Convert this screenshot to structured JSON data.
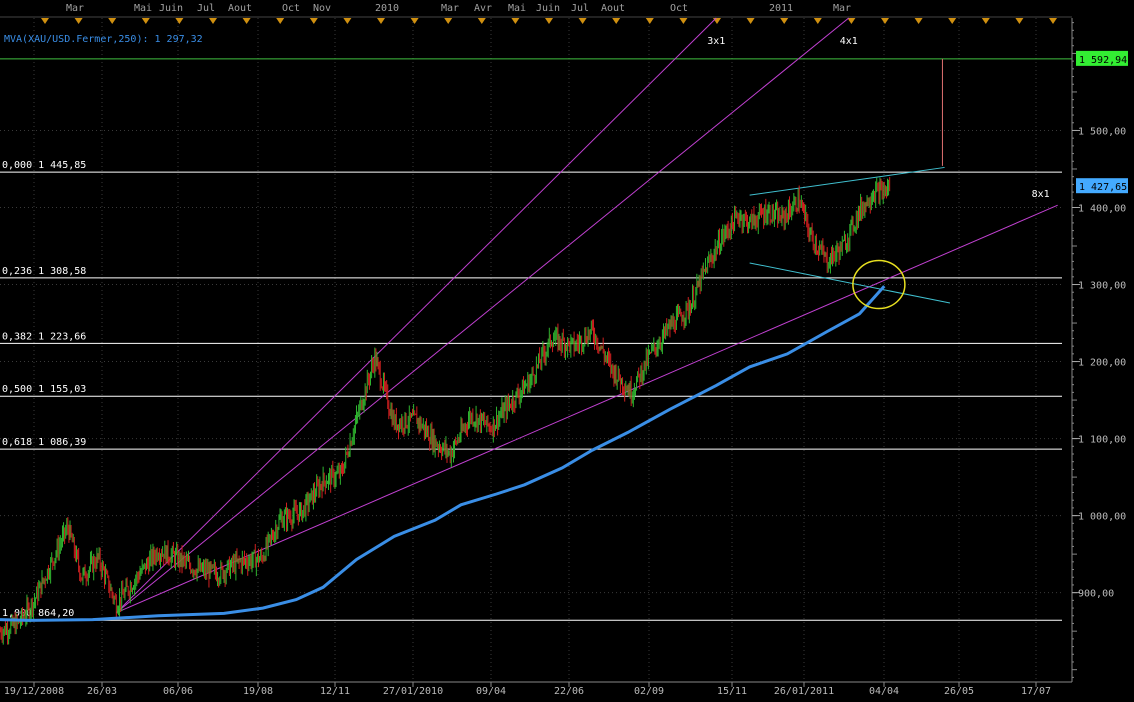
{
  "indicator_label": "MVA(XAU/USD.Fermer,250): 1 297,32",
  "colors": {
    "background": "#000000",
    "grid": "#3a3a3a",
    "bull": "#2fb52f",
    "bear": "#d02020",
    "mva": "#3a8ee6",
    "fan": "#c040d0",
    "fib": "#ffffff",
    "channel": "#40c0d0",
    "target_line": "#40c040",
    "target_box": "#33ee33",
    "price_box": "#44aaff",
    "ellipse": "#e8e020",
    "top_months": "#a0a0a0",
    "markers": "#d09010"
  },
  "chart_data": {
    "type": "line",
    "instrument": "XAU/USD",
    "top_axis_labels": [
      "Mar",
      "Mai",
      "Juin",
      "Jul",
      "Aout",
      "Oct",
      "Nov",
      "2010",
      "Mar",
      "Avr",
      "Mai",
      "Juin",
      "Jul",
      "Aout",
      "Oct",
      "2011",
      "Mar"
    ],
    "x_tick_labels": [
      "19/12/2008",
      "26/03",
      "06/06",
      "19/08",
      "12/11",
      "27/01/2010",
      "09/04",
      "22/06",
      "02/09",
      "15/11",
      "26/01/2011",
      "04/04",
      "26/05",
      "17/07"
    ],
    "y_tick_labels": [
      "1 500,00",
      "1 400,00",
      "1 300,00",
      "1 200,00",
      "1 100,00",
      "1 000,00",
      "900,00"
    ],
    "y_ticks": [
      1500,
      1400,
      1300,
      1200,
      1100,
      1000,
      900
    ],
    "ylim": [
      784,
      1646
    ],
    "xlim": [
      "2008-12-19",
      "2011-09-01"
    ],
    "grid": true,
    "fib_levels": [
      {
        "label": "0,000 1 445,85",
        "value": 1445.85
      },
      {
        "label": "0,236 1 308,58",
        "value": 1308.58
      },
      {
        "label": "0,382 1 223,66",
        "value": 1223.66
      },
      {
        "label": "0,500 1 155,03",
        "value": 1155.03
      },
      {
        "label": "0,618 1 086,39",
        "value": 1086.39
      },
      {
        "label": "1,000 864,20",
        "value": 864.2
      }
    ],
    "target": {
      "label": "1 592,94",
      "value": 1592.94
    },
    "last_price": {
      "label": "1 427,65",
      "value": 1427.65
    },
    "gann_fan": {
      "origin": {
        "x": "2009-04-06",
        "y": 874
      },
      "lines": [
        {
          "label": "3x1",
          "end": {
            "x": "2010-10-15",
            "y": 1646
          }
        },
        {
          "label": "4x1",
          "end": {
            "x": "2011-02-15",
            "y": 1646
          }
        },
        {
          "label": "8x1",
          "end": {
            "x": "2011-08-28",
            "y": 1403
          }
        }
      ]
    },
    "channel_lines": [
      {
        "start": {
          "x": "2010-11-15",
          "y": 1416
        },
        "end": {
          "x": "2011-05-15",
          "y": 1452
        }
      },
      {
        "start": {
          "x": "2010-11-15",
          "y": 1328
        },
        "end": {
          "x": "2011-05-20",
          "y": 1276
        }
      }
    ],
    "projection_line": {
      "x": "2011-05-13",
      "start": 1454,
      "end": 1592.94
    },
    "highlight_circle": {
      "x": "2011-03-15",
      "y": 1300
    },
    "series": [
      {
        "name": "MVA(XAU/USD.Fermer,250)",
        "x": [
          "2008-12-19",
          "2009-01-15",
          "2009-03-15",
          "2009-05-15",
          "2009-07-15",
          "2009-08-20",
          "2009-09-20",
          "2009-10-15",
          "2009-11-15",
          "2009-12-20",
          "2010-01-27",
          "2010-02-20",
          "2010-03-25",
          "2010-04-20",
          "2010-05-25",
          "2010-06-22",
          "2010-07-25",
          "2010-09-02",
          "2010-10-15",
          "2010-11-15",
          "2010-12-20",
          "2011-01-26",
          "2011-02-25",
          "2011-03-20"
        ],
        "values": [
          865,
          864,
          865,
          870,
          873,
          880,
          891,
          907,
          943,
          973,
          994,
          1014,
          1028,
          1040,
          1062,
          1085,
          1108,
          1138,
          1169,
          1193,
          1210,
          1239,
          1262,
          1298
        ]
      },
      {
        "name": "XAU/USD",
        "x": [
          "2008-12-19",
          "2009-01-05",
          "2009-01-20",
          "2009-02-05",
          "2009-02-20",
          "2009-03-05",
          "2009-03-20",
          "2009-04-06",
          "2009-04-25",
          "2009-05-15",
          "2009-06-01",
          "2009-06-20",
          "2009-07-10",
          "2009-07-30",
          "2009-08-19",
          "2009-09-05",
          "2009-09-25",
          "2009-10-15",
          "2009-11-01",
          "2009-11-12",
          "2009-12-02",
          "2009-12-20",
          "2010-01-10",
          "2010-01-27",
          "2010-02-10",
          "2010-03-01",
          "2010-03-20",
          "2010-04-09",
          "2010-04-25",
          "2010-05-15",
          "2010-06-05",
          "2010-06-22",
          "2010-07-10",
          "2010-07-28",
          "2010-08-15",
          "2010-09-02",
          "2010-09-20",
          "2010-10-05",
          "2010-10-20",
          "2010-11-05",
          "2010-11-15",
          "2010-12-01",
          "2010-12-15",
          "2010-12-31",
          "2011-01-10",
          "2011-01-26",
          "2011-02-10",
          "2011-02-25",
          "2011-03-10",
          "2011-03-20",
          "2011-03-25"
        ],
        "values": [
          850,
          860,
          890,
          940,
          985,
          920,
          945,
          885,
          920,
          955,
          945,
          930,
          925,
          940,
          945,
          995,
          1005,
          1045,
          1055,
          1110,
          1205,
          1120,
          1125,
          1095,
          1080,
          1130,
          1115,
          1150,
          1175,
          1230,
          1220,
          1240,
          1190,
          1160,
          1210,
          1245,
          1270,
          1320,
          1360,
          1390,
          1380,
          1395,
          1385,
          1410,
          1365,
          1330,
          1350,
          1395,
          1420,
          1420,
          1428
        ]
      }
    ]
  }
}
